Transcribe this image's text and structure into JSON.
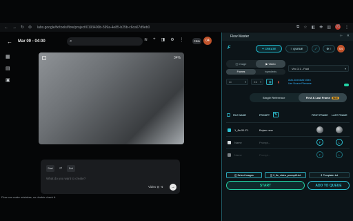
{
  "browser": {
    "url": "labs.google/fx/tools/flow/project/0193400b-599a-4e85-b25b-c6ca67d9eb0",
    "profile_initial": "05"
  },
  "app": {
    "project_date": "Mar 09 - 04:00",
    "plan_badge": "PRO",
    "avatar_initial": "04",
    "preview_progress": "34%",
    "composer": {
      "start_chip": "Start",
      "end_chip": "End",
      "placeholder": "What do you want to create?",
      "mode_label": "Video ⊡ ⊲"
    },
    "hint": "Flow can make mistakes, so double check it."
  },
  "panel": {
    "title": "Flow Master",
    "nav": {
      "logo": "F",
      "create_label": "✦ CREATE",
      "queue_label": "≡ QUEUE",
      "wand_label": "⟋",
      "gear_label": "⚙ ≡",
      "avatar_initial": "04"
    },
    "media_tabs": [
      "◫ Image",
      "▶ Video"
    ],
    "sub_tabs": [
      "Frames",
      "Ingredients"
    ],
    "model": "Veo 3.1 - Fast",
    "aspect": "▭",
    "count": "×1",
    "auto_line1": "Auto-download video",
    "auto_line2": "Use Source Filename",
    "ref_tabs": [
      "Single Reference",
      "First & Last Frame"
    ],
    "new_badge": "NEW",
    "table": {
      "col_file": "FILE NAME",
      "col_prompt": "PROMPT",
      "col_first": "FIRST FRAME",
      "col_last": "LAST FRAME",
      "rows": [
        {
          "name": "1_€a 51-F1",
          "prompt": "Bojam new",
          "first": "img",
          "last": "img",
          "active": true
        },
        {
          "name": "Name",
          "prompt": "Prompt...",
          "first": "F",
          "last": "L",
          "active": false
        },
        {
          "name": "Name",
          "prompt": "Prompt...",
          "first": "F",
          "last": "L",
          "active": false
        }
      ]
    },
    "bottom": {
      "select_images": "◫ Select Images",
      "prompt_file": "◫ 3_6s_video_prompt3.txt",
      "template": "⇩ Template .txt",
      "start": "START",
      "add_to_queue": "ADD TO QUEUE"
    }
  }
}
